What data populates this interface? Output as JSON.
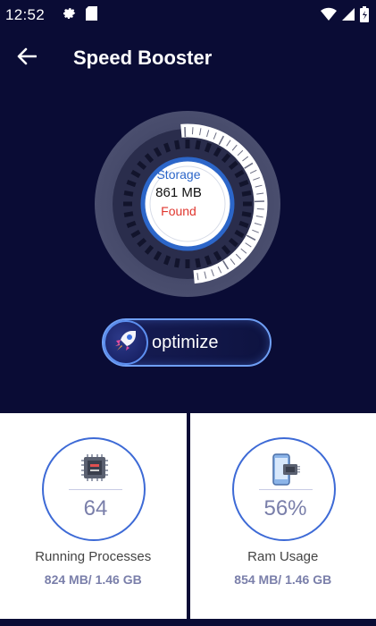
{
  "status_bar": {
    "time": "12:52",
    "icons": [
      "gear-icon",
      "sd-card-icon",
      "wifi-icon",
      "signal-icon",
      "battery-icon"
    ]
  },
  "header": {
    "title": "Speed Booster",
    "back_icon": "arrow-left-icon"
  },
  "gauge": {
    "title": "Storage",
    "value": "861 MB",
    "subtitle": "Found",
    "level": 0.5
  },
  "optimize_button": {
    "label": "optimize",
    "icon": "rocket-icon"
  },
  "cards": [
    {
      "icon": "cpu-chip-icon",
      "value": "64",
      "label": "Running Processes",
      "sub": "824 MB/ 1.46 GB"
    },
    {
      "icon": "phone-chip-icon",
      "value": "56%",
      "label": "Ram Usage",
      "sub": "854 MB/ 1.46 GB"
    }
  ],
  "colors": {
    "background": "#0a0c35",
    "accent_blue": "#2c66c9",
    "found_red": "#e0372f",
    "card_text": "#7a7faa"
  }
}
